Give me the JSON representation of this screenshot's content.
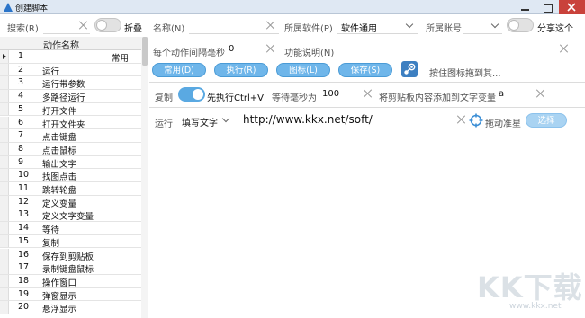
{
  "window": {
    "title": "创建脚本"
  },
  "search": {
    "label": "搜索(R)",
    "fold_label": "折叠"
  },
  "form": {
    "name_label": "名称(N)",
    "software_label": "所属软件(P)",
    "software_value": "软件通用",
    "account_label": "所属账号",
    "share_label": "分享这个",
    "interval_label": "每个动作间隔毫秒",
    "interval_value": "0",
    "desc_label": "功能说明(N)"
  },
  "buttons": {
    "common": "常用(D)",
    "execute": "执行(R)",
    "icon": "图标(L)",
    "save": "保存(S)",
    "hint": "按住图标拖到其..."
  },
  "copy_step": {
    "label": "复制",
    "ctrlv_label": "先执行Ctrl+V",
    "wait_label": "等待毫秒为",
    "wait_value": "100",
    "clipboard_label": "将剪贴板内容添加到文字变量",
    "var_value": "a"
  },
  "run_step": {
    "label": "运行",
    "mode_value": "填写文字",
    "url_value": "http://www.kkx.net/soft/",
    "drag_label": "拖动准星",
    "select_button": "选择"
  },
  "grid": {
    "header": "动作名称",
    "rows": [
      {
        "num": "1",
        "name": "",
        "tag": "常用",
        "selected": true
      },
      {
        "num": "2",
        "name": "运行"
      },
      {
        "num": "3",
        "name": "运行带参数"
      },
      {
        "num": "4",
        "name": "多路径运行"
      },
      {
        "num": "5",
        "name": "打开文件"
      },
      {
        "num": "6",
        "name": "打开文件夹"
      },
      {
        "num": "7",
        "name": "点击键盘"
      },
      {
        "num": "8",
        "name": "点击鼠标"
      },
      {
        "num": "9",
        "name": "输出文字"
      },
      {
        "num": "10",
        "name": "找图点击"
      },
      {
        "num": "11",
        "name": "跳转轮盘"
      },
      {
        "num": "12",
        "name": "定义变量"
      },
      {
        "num": "13",
        "name": "定义文字变量"
      },
      {
        "num": "14",
        "name": "等待"
      },
      {
        "num": "15",
        "name": "复制"
      },
      {
        "num": "16",
        "name": "保存到剪贴板"
      },
      {
        "num": "17",
        "name": "录制键盘鼠标"
      },
      {
        "num": "18",
        "name": "操作窗口"
      },
      {
        "num": "19",
        "name": "弹窗显示"
      },
      {
        "num": "20",
        "name": "悬浮显示"
      }
    ]
  },
  "watermark": {
    "text": "KK下载",
    "url": "www.kkx.net"
  },
  "colors": {
    "accent": "#6fb6ea",
    "toggle_on": "#5aa9e2",
    "close": "#c9423b"
  }
}
